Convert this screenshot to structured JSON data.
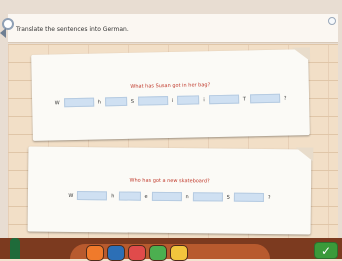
{
  "header": {
    "instruction": "Translate the sentences into German."
  },
  "cards": [
    {
      "question": "What has Susan got in her bag?",
      "tokens": [
        "W",
        "h",
        "S",
        "i",
        "i",
        "T",
        "?"
      ]
    },
    {
      "question": "Who has got a new skateboard?",
      "tokens": [
        "W",
        "h",
        "e",
        "n",
        "S",
        "?"
      ]
    }
  ],
  "dock": {
    "items": [
      "bottle-icon",
      "basket-icon",
      "calculator-icon",
      "clock-icon",
      "book-icon",
      "folder-icon"
    ]
  },
  "colors": {
    "question": "#c0392b",
    "input_fill": "#cfe0f2",
    "bottom_bar": "#7c3a1f",
    "accent_green": "#3a9a3a"
  }
}
